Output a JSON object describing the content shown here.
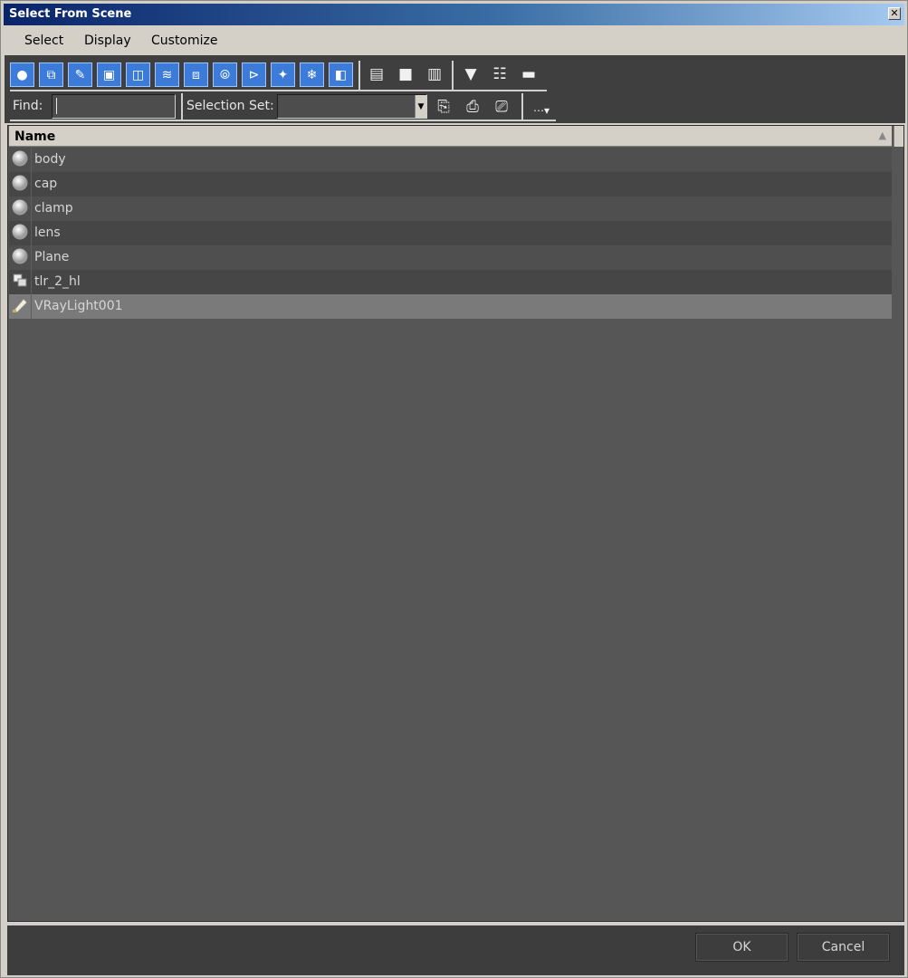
{
  "window": {
    "title": "Select From Scene",
    "close_glyph": "✕"
  },
  "menubar": {
    "items": [
      "Select",
      "Display",
      "Customize"
    ]
  },
  "toolbar": {
    "filter_icons": [
      "geometry-icon",
      "shapes-icon",
      "lights-icon",
      "cameras-icon",
      "helpers-icon",
      "space-warps-icon",
      "groups-icon",
      "xrefs-icon",
      "bones-icon",
      "containers-icon",
      "frozen-icon",
      "hidden-icon"
    ],
    "display_icons": [
      "display-all-icon",
      "display-none-icon",
      "display-invert-icon",
      "filter-icon",
      "filter-options-icon",
      "hide-toolbar-icon"
    ],
    "find_label": "Find:",
    "find_value": "",
    "selection_set_label": "Selection Set:",
    "selection_set_value": "",
    "set_icons": [
      "select-children-icon",
      "select-dependents-icon",
      "select-influences-icon"
    ]
  },
  "list": {
    "header": "Name",
    "sort_glyph": "▲",
    "rows": [
      {
        "name": "body",
        "icon": "geometry-icon"
      },
      {
        "name": "cap",
        "icon": "geometry-icon"
      },
      {
        "name": "clamp",
        "icon": "geometry-icon"
      },
      {
        "name": "lens",
        "icon": "geometry-icon"
      },
      {
        "name": "Plane",
        "icon": "geometry-icon"
      },
      {
        "name": "tlr_2_hl",
        "icon": "group-icon"
      },
      {
        "name": "VRayLight001",
        "icon": "light-icon",
        "selected": true
      }
    ]
  },
  "buttons": {
    "ok": "OK",
    "cancel": "Cancel"
  }
}
